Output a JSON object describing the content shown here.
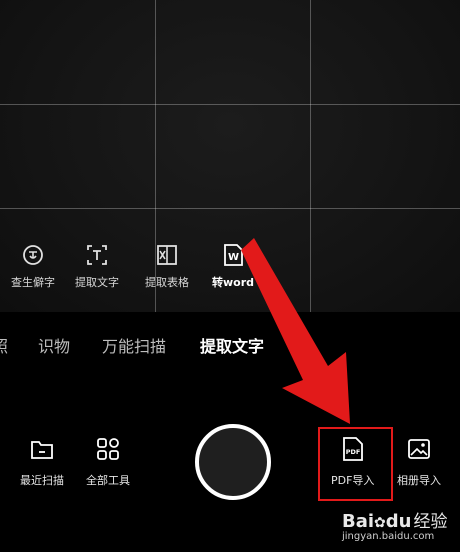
{
  "tools": [
    {
      "label": "查生僻字",
      "icon": "rare-character-icon"
    },
    {
      "label": "提取文字",
      "icon": "extract-text-icon"
    },
    {
      "label": "提取表格",
      "icon": "extract-table-icon"
    },
    {
      "label": "转word",
      "icon": "word-icon",
      "icon_text": "W"
    }
  ],
  "modes": [
    {
      "label": "照"
    },
    {
      "label": "识物"
    },
    {
      "label": "万能扫描"
    },
    {
      "label": "提取文字",
      "selected": true
    }
  ],
  "controls": {
    "recent_scan": "最近扫描",
    "all_tools": "全部工具",
    "pdf_import": "PDF导入",
    "pdf_icon_text": "PDF",
    "album_import": "相册导入"
  },
  "annotation": {
    "color": "#e21a1a"
  },
  "watermark": {
    "brand_left": "Bai",
    "brand_right": "du",
    "text": "经验",
    "sub": "jingyan.baidu.com"
  }
}
